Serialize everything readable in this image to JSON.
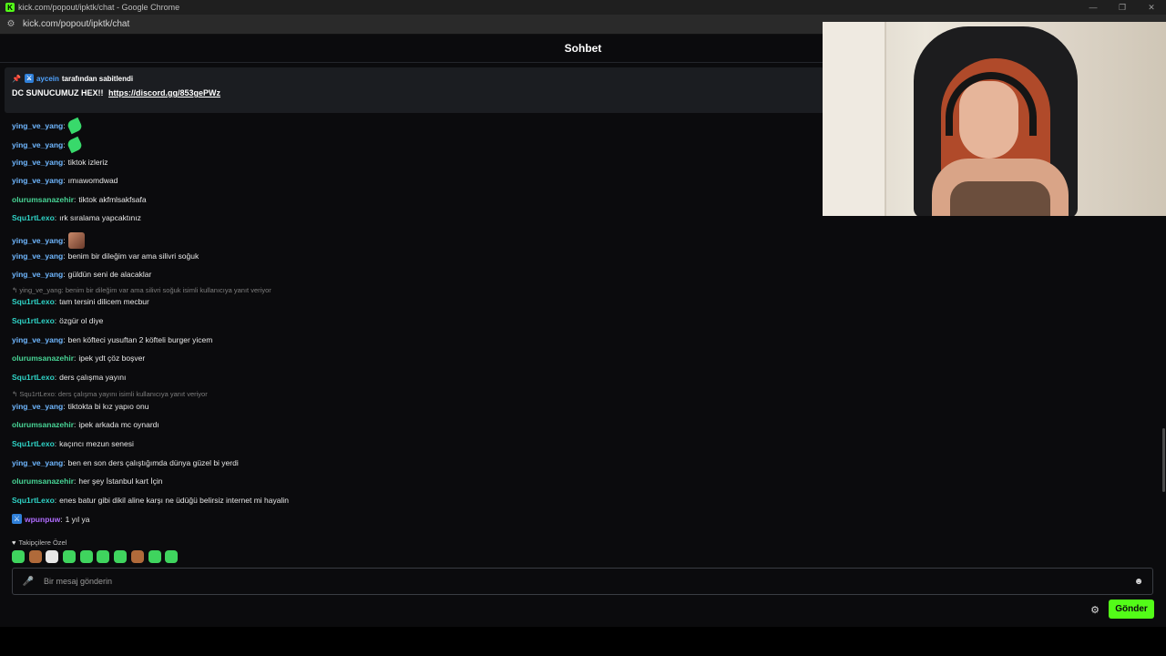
{
  "browser": {
    "window_title": "kick.com/popout/ipktk/chat - Google Chrome",
    "url": "kick.com/popout/ipktk/chat"
  },
  "chat": {
    "title": "Sohbet",
    "pinned": {
      "pinned_by_user": "aycein",
      "pinned_by_suffix": "tarafından sabitlendi",
      "message": "DC SUNUCUMUZ HEX!!",
      "link": "https://discord.gg/853gePWz"
    },
    "messages": [
      {
        "user": "ying_ve_yang",
        "text": "",
        "emote": "leaf"
      },
      {
        "user": "ying_ve_yang",
        "text": "",
        "emote": "leaf"
      },
      {
        "user": "ying_ve_yang",
        "text": "tiktok izleriz"
      },
      {
        "user": "ying_ve_yang",
        "text": "ımıawomdwad"
      },
      {
        "user": "olurumsanazehir",
        "text": "tiktok akfmlsakfsafa"
      },
      {
        "user": "Squ1rtLexo",
        "text": "ırk sıralama yapcaktınız"
      },
      {
        "user": "ying_ve_yang",
        "text": "",
        "emote": "face"
      },
      {
        "user": "ying_ve_yang",
        "text": "benim bir dileğim var ama silivri soğuk"
      },
      {
        "user": "ying_ve_yang",
        "text": "güldün seni de alacaklar"
      },
      {
        "user": "Squ1rtLexo",
        "text": "tam tersini dilicem mecbur"
      },
      {
        "user": "Squ1rtLexo",
        "text": "özgür ol diye"
      },
      {
        "user": "ying_ve_yang",
        "text": "ben köfteci yusuftan 2 köfteli burger yicem"
      },
      {
        "user": "olurumsanazehir",
        "text": "ipek ydt çöz boşver"
      },
      {
        "user": "Squ1rtLexo",
        "text": "ders çalışma yayını"
      },
      {
        "user": "ying_ve_yang",
        "text": "tiktokta bi kız yapıo onu"
      },
      {
        "user": "olurumsanazehir",
        "text": "ipek arkada mc oynardı"
      },
      {
        "user": "Squ1rtLexo",
        "text": "kaçıncı mezun senesi"
      },
      {
        "user": "ying_ve_yang",
        "text": "ben en son ders çalıştığımda dünya güzel bi yerdi"
      },
      {
        "user": "olurumsanazehir",
        "text": "her şey İstanbul kart İçin"
      },
      {
        "user": "Squ1rtLexo",
        "text": "enes batur gibi dikil aline karşı ne üdüğü belirsiz internet mi hayalin"
      },
      {
        "user": "wpunpuw",
        "text": "1 yıl ya",
        "badge": true
      }
    ],
    "replies": [
      "ying_ve_yang: benim bir dileğim var ama silivri soğuk isimli kullanıcıya yanıt veriyor",
      "Squ1rtLexo: ders çalışma yayını isimli kullanıcıya yanıt veriyor"
    ],
    "followers_only_label": "Takipçilere Özel",
    "input_placeholder": "Bir mesaj gönderin",
    "send_label": "Gönder"
  },
  "colors": {
    "accent": "#53fc18",
    "user_blue": "#6fb7ff",
    "user_green": "#48d596",
    "user_teal": "#2fd3c6",
    "user_purple": "#b06cff"
  }
}
